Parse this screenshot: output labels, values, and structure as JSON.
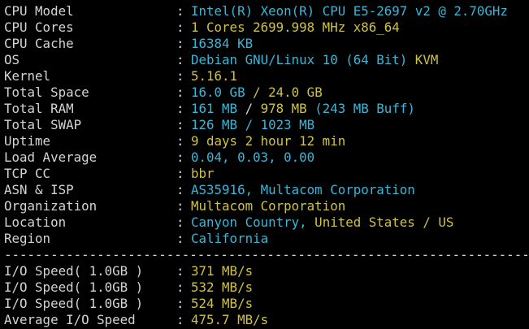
{
  "colors": {
    "background": "#000000",
    "label": "#d4d4d4",
    "cyan": "#3ab6d6",
    "yellow": "#cfc244"
  },
  "sysinfo": [
    {
      "label": "CPU Model",
      "parts": [
        {
          "text": "Intel(R) Xeon(R) CPU E5-2697 v2 @ 2.70GHz",
          "color": "cyan"
        }
      ]
    },
    {
      "label": "CPU Cores",
      "parts": [
        {
          "text": "1 Cores 2699.998 MHz x86_64",
          "color": "yellow"
        }
      ]
    },
    {
      "label": "CPU Cache",
      "parts": [
        {
          "text": "16384 KB",
          "color": "cyan"
        }
      ]
    },
    {
      "label": "OS",
      "parts": [
        {
          "text": "Debian GNU/Linux 10 (64 Bit)",
          "color": "cyan"
        },
        {
          "text": " KVM",
          "color": "yellow"
        }
      ]
    },
    {
      "label": "Kernel",
      "parts": [
        {
          "text": "5.16.1",
          "color": "yellow"
        }
      ]
    },
    {
      "label": "Total Space",
      "parts": [
        {
          "text": "16.0 GB",
          "color": "cyan"
        },
        {
          "text": " / ",
          "color": "yellow"
        },
        {
          "text": "24.0 GB",
          "color": "yellow"
        }
      ]
    },
    {
      "label": "Total RAM",
      "parts": [
        {
          "text": "161 MB",
          "color": "cyan"
        },
        {
          "text": " / ",
          "color": "white"
        },
        {
          "text": "978 MB",
          "color": "yellow"
        },
        {
          "text": " (243 MB Buff)",
          "color": "cyan"
        }
      ]
    },
    {
      "label": "Total SWAP",
      "parts": [
        {
          "text": "126 MB / 1023 MB",
          "color": "cyan"
        }
      ]
    },
    {
      "label": "Uptime",
      "parts": [
        {
          "text": "9 days 2 hour 12 min",
          "color": "yellow"
        }
      ]
    },
    {
      "label": "Load Average",
      "parts": [
        {
          "text": "0.04, 0.03, 0.00",
          "color": "cyan"
        }
      ]
    },
    {
      "label": "TCP CC",
      "parts": [
        {
          "text": "bbr",
          "color": "yellow"
        }
      ]
    },
    {
      "label": "ASN & ISP",
      "parts": [
        {
          "text": "AS35916, Multacom Corporation",
          "color": "cyan"
        }
      ]
    },
    {
      "label": "Organization",
      "parts": [
        {
          "text": "Multacom Corporation",
          "color": "yellow"
        }
      ]
    },
    {
      "label": "Location",
      "parts": [
        {
          "text": "Canyon Country,",
          "color": "cyan"
        },
        {
          "text": " United States / US",
          "color": "yellow"
        }
      ]
    },
    {
      "label": "Region",
      "parts": [
        {
          "text": "California",
          "color": "cyan"
        }
      ]
    }
  ],
  "divider": "----------------------------------------------------------------------",
  "io": [
    {
      "label": "I/O Speed( 1.0GB )",
      "parts": [
        {
          "text": "371 MB/s",
          "color": "yellow"
        }
      ]
    },
    {
      "label": "I/O Speed( 1.0GB )",
      "parts": [
        {
          "text": "532 MB/s",
          "color": "yellow"
        }
      ]
    },
    {
      "label": "I/O Speed( 1.0GB )",
      "parts": [
        {
          "text": "524 MB/s",
          "color": "yellow"
        }
      ]
    },
    {
      "label": "Average I/O Speed",
      "parts": [
        {
          "text": "475.7 MB/s",
          "color": "yellow"
        }
      ]
    }
  ],
  "separator": ":"
}
